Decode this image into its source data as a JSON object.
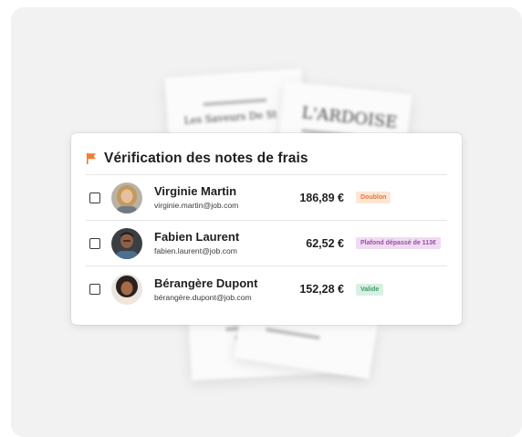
{
  "card": {
    "title": "Vérification des notes de frais",
    "accent_color": "#f07b2e"
  },
  "receipts": {
    "left_header": "Les Saveurs De St",
    "right_header": "L'ARDOISE"
  },
  "rows": [
    {
      "name": "Virginie Martin",
      "email": "virginie.martin@job.com",
      "amount": "186,89 €",
      "badge": "Doublon",
      "badge_bg": "#fde6d6",
      "badge_fg": "#e2793a"
    },
    {
      "name": "Fabien Laurent",
      "email": "fabien.laurent@job.com",
      "amount": "62,52 €",
      "badge": "Plafond dépassé de 113€",
      "badge_bg": "#f0dcf2",
      "badge_fg": "#9a4fa6"
    },
    {
      "name": "Bérangère Dupont",
      "email": "bérangère.dupont@job.com",
      "amount": "152,28 €",
      "badge": "Valide",
      "badge_bg": "#d9f1e3",
      "badge_fg": "#3f9a66"
    }
  ]
}
